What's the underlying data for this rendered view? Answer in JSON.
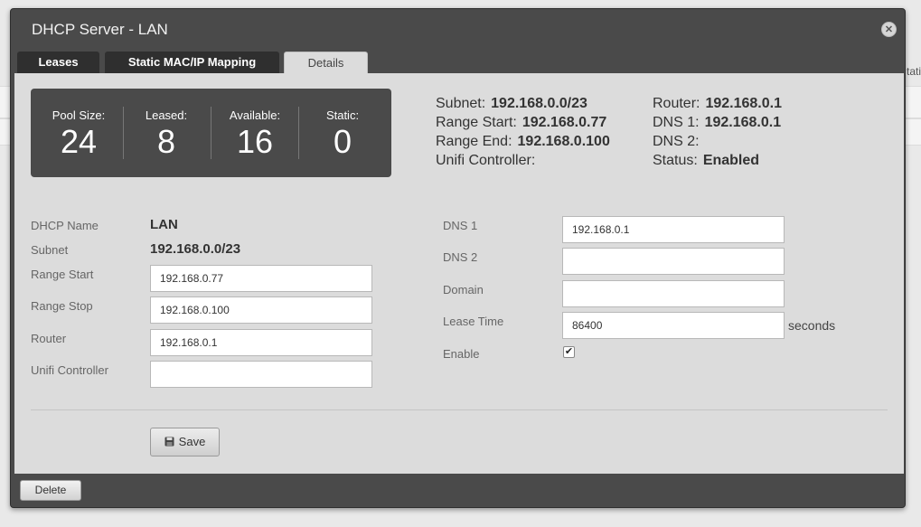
{
  "background": {
    "edge_text": "tati"
  },
  "dialog": {
    "title": "DHCP Server - LAN",
    "close_glyph": "✕"
  },
  "tabs": [
    {
      "label": "Leases",
      "active": false
    },
    {
      "label": "Static MAC/IP Mapping",
      "active": false
    },
    {
      "label": "Details",
      "active": true
    }
  ],
  "stats": {
    "pool_size": {
      "label": "Pool Size:",
      "value": "24"
    },
    "leased": {
      "label": "Leased:",
      "value": "8"
    },
    "available": {
      "label": "Available:",
      "value": "16"
    },
    "static": {
      "label": "Static:",
      "value": "0"
    }
  },
  "summary": {
    "subnet": {
      "label": "Subnet:",
      "value": "192.168.0.0/23"
    },
    "range_start": {
      "label": "Range Start:",
      "value": "192.168.0.77"
    },
    "range_end": {
      "label": "Range End:",
      "value": "192.168.0.100"
    },
    "unifi_controller": {
      "label": "Unifi Controller:",
      "value": ""
    },
    "router": {
      "label": "Router:",
      "value": "192.168.0.1"
    },
    "dns1": {
      "label": "DNS 1:",
      "value": "192.168.0.1"
    },
    "dns2": {
      "label": "DNS 2:",
      "value": ""
    },
    "status": {
      "label": "Status:",
      "value": "Enabled"
    }
  },
  "form": {
    "dhcp_name": {
      "label": "DHCP Name",
      "value": "LAN"
    },
    "subnet": {
      "label": "Subnet",
      "value": "192.168.0.0/23"
    },
    "range_start": {
      "label": "Range Start",
      "value": "192.168.0.77"
    },
    "range_stop": {
      "label": "Range Stop",
      "value": "192.168.0.100"
    },
    "router": {
      "label": "Router",
      "value": "192.168.0.1"
    },
    "unifi_controller": {
      "label": "Unifi Controller",
      "value": ""
    },
    "dns1": {
      "label": "DNS 1",
      "value": "192.168.0.1"
    },
    "dns2": {
      "label": "DNS 2",
      "value": ""
    },
    "domain": {
      "label": "Domain",
      "value": ""
    },
    "lease_time": {
      "label": "Lease Time",
      "value": "86400",
      "unit": "seconds"
    },
    "enable": {
      "label": "Enable",
      "checked": true,
      "glyph": "✔"
    }
  },
  "buttons": {
    "save": "Save",
    "delete": "Delete"
  },
  "icons": {
    "save": "floppy-disk-icon",
    "close": "close-icon"
  }
}
